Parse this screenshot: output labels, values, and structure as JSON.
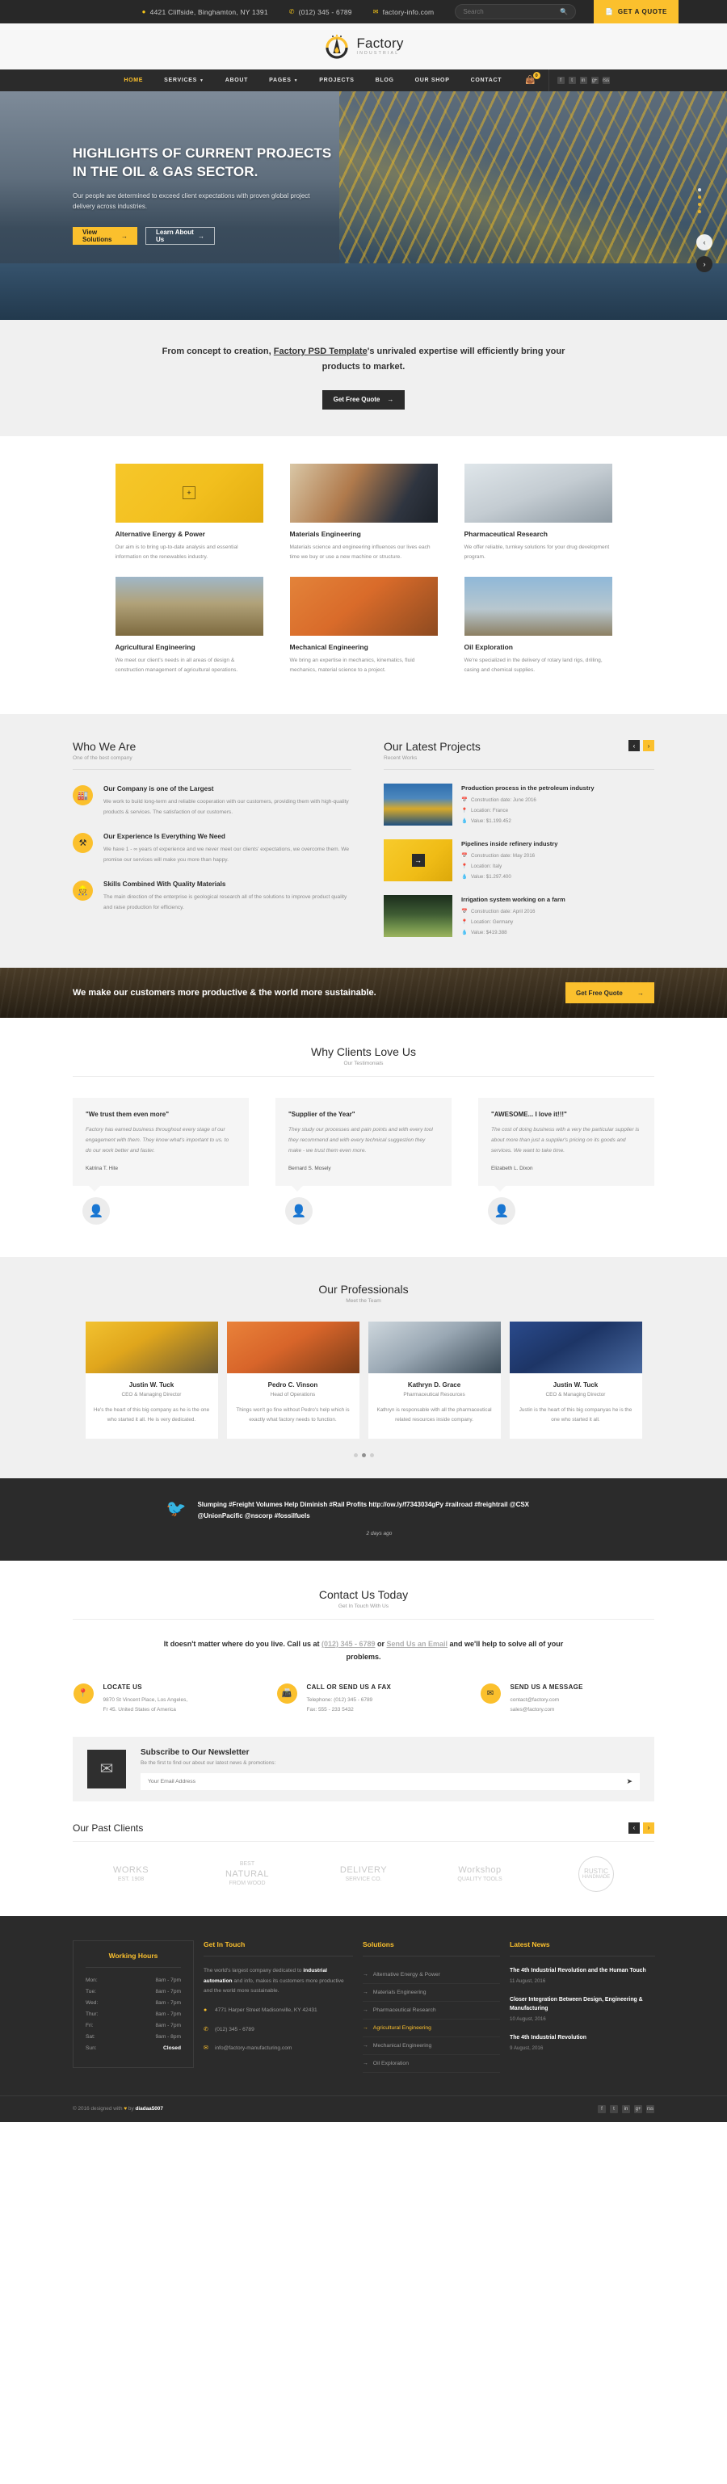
{
  "topbar": {
    "address": "4421 Cliffside, Binghamton, NY 1391",
    "phone": "(012) 345 - 6789",
    "email": "factory-info.com",
    "search_placeholder": "Search",
    "quote_label": "GET A QUOTE"
  },
  "brand": {
    "name": "Factory",
    "tagline": "INDUSTRIAL"
  },
  "nav": {
    "items": [
      {
        "label": "HOME",
        "active": true,
        "caret": false
      },
      {
        "label": "SERVICES",
        "active": false,
        "caret": true
      },
      {
        "label": "ABOUT",
        "active": false,
        "caret": false
      },
      {
        "label": "PAGES",
        "active": false,
        "caret": true
      },
      {
        "label": "PROJECTS",
        "active": false,
        "caret": false
      },
      {
        "label": "BLOG",
        "active": false,
        "caret": false
      },
      {
        "label": "OUR SHOP",
        "active": false,
        "caret": false
      },
      {
        "label": "CONTACT",
        "active": false,
        "caret": false
      }
    ],
    "cart_count": "0",
    "social": [
      "f",
      "t",
      "in",
      "g+",
      "rss"
    ]
  },
  "hero": {
    "title_line1": "HIGHLIGHTS OF CURRENT PROJECTS",
    "title_line2": "IN THE OIL & GAS SECTOR.",
    "paragraph": "Our people are determined to exceed client expectations with proven global project delivery across industries.",
    "primary_btn": "View Solutions",
    "secondary_btn": "Learn About Us",
    "arrow": "→"
  },
  "intro": {
    "text_before": "From concept to creation, ",
    "text_link": "Factory PSD Template",
    "text_after": "'s unrivaled expertise will efficiently bring your products to market.",
    "button": "Get Free Quote"
  },
  "services": [
    {
      "title": "Alternative Energy & Power",
      "desc": "Our aim is to bring up-to-date analysis and essential information on the renewables industry.",
      "img": "im-solar"
    },
    {
      "title": "Materials Engineering",
      "desc": "Materials science and engineering influences our lives each time we buy or use a new machine or structure.",
      "img": "im-weld"
    },
    {
      "title": "Pharmaceutical Research",
      "desc": "We offer reliable, turnkey solutions for your drug development program.",
      "img": "im-lab"
    },
    {
      "title": "Agricultural Engineering",
      "desc": "We meet our client's needs in all areas of design & construction management of agricultural operations.",
      "img": "im-farm"
    },
    {
      "title": "Mechanical Engineering",
      "desc": "We bring an expertise in mechanics, kinematics, fluid mechanics, material science to a project.",
      "img": "im-crane"
    },
    {
      "title": "Oil Exploration",
      "desc": "We're specialized in the delivery of rotary land rigs, drilling, casing and chemical supplies.",
      "img": "im-oil"
    }
  ],
  "who": {
    "heading": "Who We Are",
    "sub": "One of the best company",
    "features": [
      {
        "icon": "🏭",
        "title": "Our Company is one of the Largest",
        "desc": "We work to build long-term and reliable cooperation with our customers, providing them with high-quality products & services. The satisfaction of our customers."
      },
      {
        "icon": "⚒",
        "title": "Our Experience Is Everything We Need",
        "desc": "We have 1 - ∞ years of experience and we never meet our clients' expectations, we overcome them. We promise our services will make you more than happy."
      },
      {
        "icon": "👷",
        "title": "Skills Combined With Quality Materials",
        "desc": "The main direction of the enterprise is geological research all of the solutions to improve product quality and raise production for efficiency."
      }
    ]
  },
  "projects": {
    "heading": "Our Latest Projects",
    "sub": "Recent Works",
    "items": [
      {
        "title": "Production process in the petroleum industry",
        "date": "Construction date: June 2016",
        "location": "Location: France",
        "value": "Value: $1.199.452",
        "img": "pj1"
      },
      {
        "title": "Pipelines inside refinery industry",
        "date": "Construction date: May 2016",
        "location": "Location: Italy",
        "value": "Value: $1.297.400",
        "img": "pj2"
      },
      {
        "title": "Irrigation system working on a farm",
        "date": "Construction date: April 2016",
        "location": "Location: Germany",
        "value": "Value: $419.388",
        "img": "pj3"
      }
    ]
  },
  "cta": {
    "text": "We make our customers more productive & the world more sustainable.",
    "button": "Get Free Quote"
  },
  "testimonials": {
    "heading": "Why Clients Love Us",
    "sub": "Our Testimonials",
    "items": [
      {
        "quote": "\"We trust them even more\"",
        "body": "Factory has earned business throughout every stage of our engagement with them. They know what's important to us. to do our work better and faster.",
        "name": "Katrina T. Hite"
      },
      {
        "quote": "\"Supplier of the Year\"",
        "body": "They study our processes and pain points and with every tool they recommend and with every technical suggestion they make - we trust them even more.",
        "name": "Bernard S. Mosely"
      },
      {
        "quote": "\"AWESOME... I love it!!!\"",
        "body": "The cost of doing business with a very the particular supplier is about more than just a supplier's pricing on its goods and services. We want to take time.",
        "name": "Elizabeth L. Dixon"
      }
    ]
  },
  "team": {
    "heading": "Our Professionals",
    "sub": "Meet the Team",
    "members": [
      {
        "name": "Justin W. Tuck",
        "role": "CEO & Managing Director",
        "bio": "He's the heart of this big company as he is the one who started it all. He is very dedicated.",
        "img": "tmi1"
      },
      {
        "name": "Pedro C. Vinson",
        "role": "Head of Operations",
        "bio": "Things won't go fine without Pedro's help which is exactly what factory needs to function.",
        "img": "tmi2"
      },
      {
        "name": "Kathryn D. Grace",
        "role": "Pharmaceutical Resources",
        "bio": "Kathryn is responsable with all the pharmaceutical related resources inside company.",
        "img": "tmi3"
      },
      {
        "name": "Justin W. Tuck",
        "role": "CEO & Managing Director",
        "bio": "Justin is the heart of this big companyas he is the one who started it all.",
        "img": "tmi4"
      }
    ]
  },
  "twitter": {
    "text": "Slumping #Freight Volumes Help Diminish #Rail Profits http://ow.ly/f7343034gPy  #railroad #freightrail @CSX @UnionPacific @nscorp #fossilfuels",
    "ago": "2 days ago"
  },
  "contact": {
    "heading": "Contact Us Today",
    "sub": "Get In Touch With Us",
    "line_1": "It doesn't matter where do you live. Call us at ",
    "phone_link": "(012) 345 - 6789",
    "line_2": " or ",
    "email_link": "Send Us an Email",
    "line_3": " and we'll help to solve all of your problems.",
    "cells": [
      {
        "icon": "📍",
        "title": "LOCATE US",
        "lines": "9870 St Vincent Place, Los Angeles,\nFr 45. United States of America"
      },
      {
        "icon": "📠",
        "title": "CALL OR SEND US A FAX",
        "lines": "Telephone: (012) 345 - 6789\nFax: 555 - 233 5432"
      },
      {
        "icon": "✉",
        "title": "SEND US A MESSAGE",
        "lines": "contact@factory.com\nsales@factory.com"
      }
    ]
  },
  "newsletter": {
    "title": "Subscribe to Our Newsletter",
    "subtitle": "Be the first to find our about our latest news & promotions:",
    "placeholder": "Your Email Address"
  },
  "clients": {
    "heading": "Our Past Clients",
    "logos": [
      {
        "top": "",
        "big": "WORKS",
        "bottom": "EST. 1908"
      },
      {
        "top": "BEST",
        "big": "NATURAL",
        "bottom": "FROM WOOD"
      },
      {
        "top": "",
        "big": "DELIVERY",
        "bottom": "SERVICE CO."
      },
      {
        "top": "",
        "big": "Workshop",
        "bottom": "QUALITY TOOLS"
      },
      {
        "top": "",
        "big": "RUSTIC",
        "bottom": "HANDMADE"
      }
    ]
  },
  "footer": {
    "hours_title": "Working Hours",
    "hours": [
      {
        "day": "Mon:",
        "time": "8am - 7pm"
      },
      {
        "day": "Tue:",
        "time": "8am - 7pm"
      },
      {
        "day": "Wed:",
        "time": "8am - 7pm"
      },
      {
        "day": "Thur:",
        "time": "8am - 7pm"
      },
      {
        "day": "Fri:",
        "time": "8am - 7pm"
      },
      {
        "day": "Sat:",
        "time": "9am - 8pm"
      },
      {
        "day": "Sun:",
        "time": "Closed"
      }
    ],
    "touch_title": "Get In Touch",
    "touch_p_1": "The world's largest company dedicated to ",
    "touch_p_b": "industrial automation",
    "touch_p_2": " and info, makes its customers more productive and the world more sustainable.",
    "touch_address": "4771 Harper Street Madisonville, KY 42431",
    "touch_phone": "(012) 345 - 6789",
    "touch_email": "info@factory-manufacturing.com",
    "solutions_title": "Solutions",
    "solutions": [
      {
        "label": "Alternative Energy & Power",
        "active": false
      },
      {
        "label": "Materials Engineering",
        "active": false
      },
      {
        "label": "Pharmaceutical Research",
        "active": false
      },
      {
        "label": "Agricultural Engineering",
        "active": true
      },
      {
        "label": "Mechanical Engineering",
        "active": false
      },
      {
        "label": "Oil Exploration",
        "active": false
      }
    ],
    "news_title": "Latest News",
    "news": [
      {
        "title": "The 4th Industrial Revolution and the Human Touch",
        "date": "11 August, 2016"
      },
      {
        "title": "Closer Integration Between Design, Engineering & Manufacturing",
        "date": "10 August, 2016"
      },
      {
        "title": "The 4th Industrial Revolution",
        "date": "9 August, 2016"
      }
    ],
    "copyright_pre": "© 2016 designed with ",
    "copyright_heart": "♥",
    "copyright_mid": " by ",
    "copyright_author": "diadaa5007",
    "social": [
      "f",
      "t",
      "in",
      "g+",
      "rss"
    ]
  },
  "colors": {
    "accent": "#fbc02d",
    "dark": "#2b2b2b",
    "light": "#f0f0f0"
  }
}
